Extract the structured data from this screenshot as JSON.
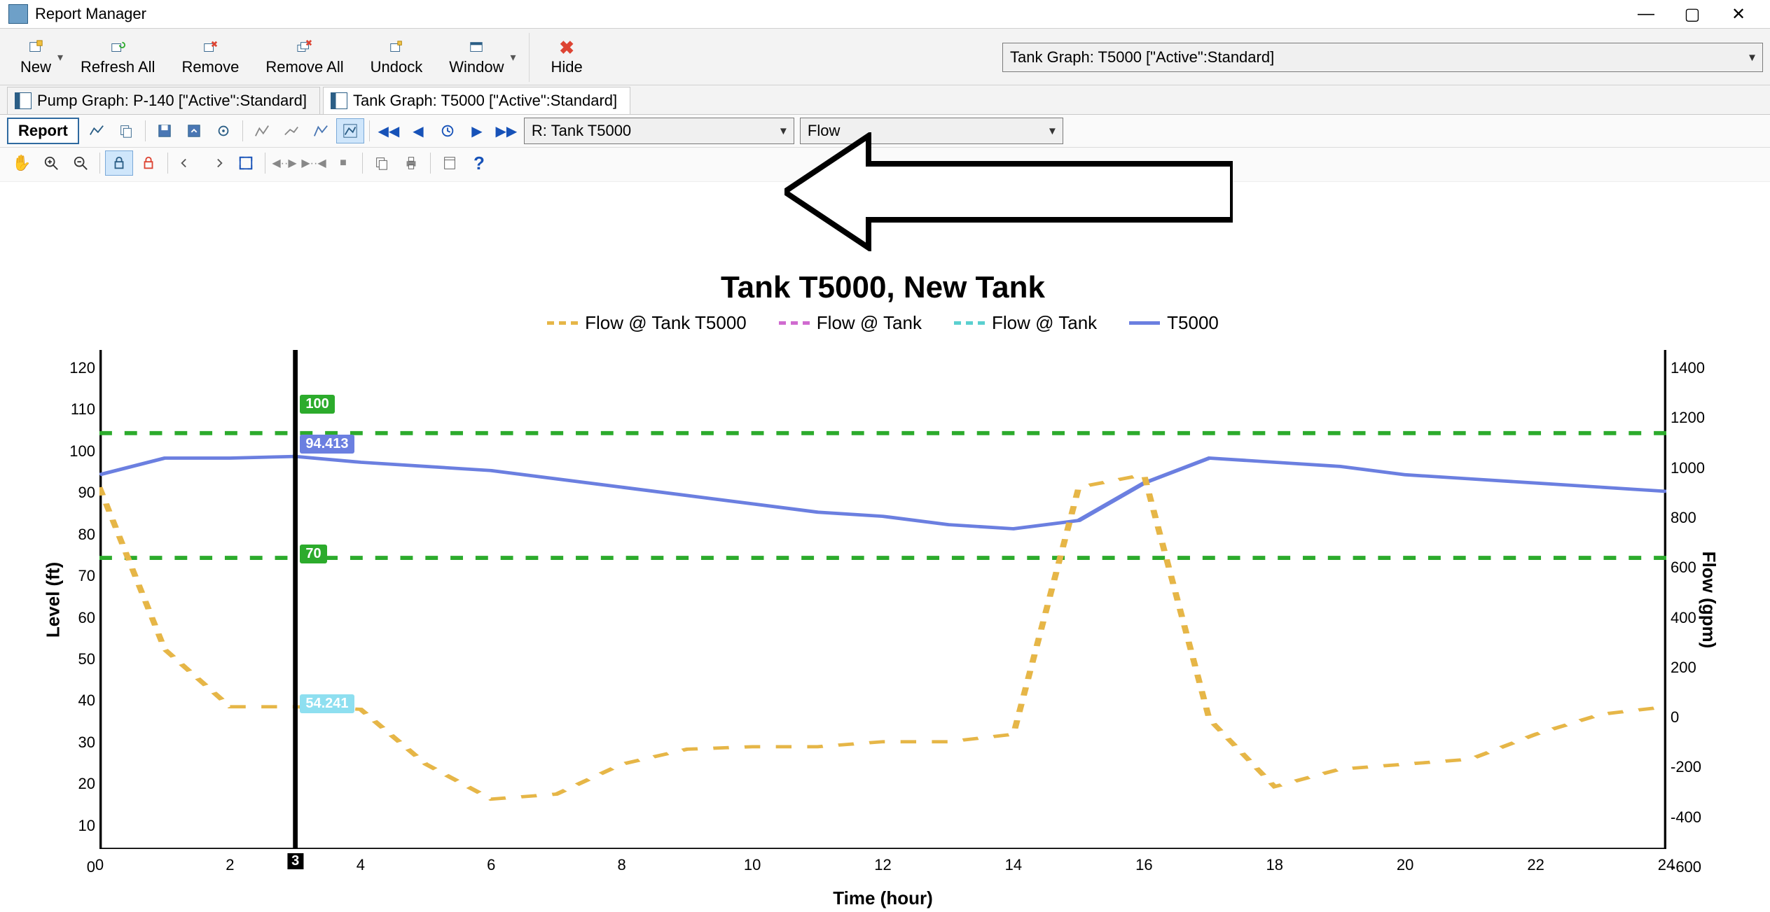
{
  "window": {
    "title": "Report Manager"
  },
  "ribbon": {
    "new": "New",
    "refresh_all": "Refresh All",
    "remove": "Remove",
    "remove_all": "Remove All",
    "undock": "Undock",
    "window": "Window",
    "hide": "Hide",
    "scenario_selected": "Tank Graph: T5000 [\"Active\":Standard]"
  },
  "doc_tabs": {
    "tab1": "Pump Graph: P-140 [\"Active\":Standard]",
    "tab2": "Tank Graph: T5000 [\"Active\":Standard]"
  },
  "chart_toolbar": {
    "report_btn": "Report",
    "element_dd": "R: Tank T5000",
    "property_dd": "Flow"
  },
  "chart_labels": {
    "title": "Tank T5000, New Tank",
    "legend": {
      "s1": "Flow @ Tank T5000",
      "s2": "Flow @ Tank",
      "s3": "Flow @ Tank",
      "s4": "T5000"
    },
    "xaxis": "Time (hour)",
    "yaxis_left": "Level (ft)",
    "yaxis_right": "Flow (gpm)"
  },
  "cursor": {
    "x": "3",
    "top_band": "100",
    "level_val": "94.413",
    "bottom_band": "70",
    "flow_val": "54.241"
  },
  "chart_data": {
    "type": "line",
    "title": "Tank T5000, New Tank",
    "xlabel": "Time (hour)",
    "x": [
      0,
      1,
      2,
      3,
      4,
      5,
      6,
      7,
      8,
      9,
      10,
      11,
      12,
      13,
      14,
      15,
      16,
      17,
      18,
      19,
      20,
      21,
      22,
      23,
      24
    ],
    "x_ticks": [
      0,
      2,
      4,
      6,
      8,
      10,
      12,
      14,
      16,
      18,
      20,
      22,
      24
    ],
    "y_left": {
      "label": "Level (ft)",
      "range": [
        0,
        120
      ],
      "ticks": [
        0,
        10,
        20,
        30,
        40,
        50,
        60,
        70,
        80,
        90,
        100,
        110,
        120
      ]
    },
    "y_right": {
      "label": "Flow (gpm)",
      "range": [
        -600,
        1400
      ],
      "ticks": [
        -600,
        -400,
        -200,
        0,
        200,
        400,
        600,
        800,
        1000,
        1200,
        1400
      ]
    },
    "reference_lines": [
      {
        "axis": "left",
        "value": 100,
        "color": "#2cab2c",
        "style": "dashed"
      },
      {
        "axis": "left",
        "value": 70,
        "color": "#2cab2c",
        "style": "dashed"
      }
    ],
    "cursor_x": 3,
    "cursor_readouts": [
      {
        "series": "upper-band",
        "value": 100
      },
      {
        "series": "T5000",
        "value": 94.413
      },
      {
        "series": "lower-band",
        "value": 70
      },
      {
        "series": "Flow @ Tank",
        "value": 54.241
      }
    ],
    "series": [
      {
        "name": "T5000",
        "axis": "left",
        "color": "#6b7fe0",
        "style": "solid",
        "values": [
          90,
          94,
          94,
          94.4,
          93,
          92,
          91,
          89,
          87,
          85,
          83,
          81,
          80,
          78,
          77,
          79,
          88,
          94,
          93,
          92,
          90,
          89,
          88,
          87,
          86
        ]
      },
      {
        "name": "Flow @ Tank T5000",
        "axis": "right",
        "color": "#e6b647",
        "style": "dashed",
        "values": [
          850,
          200,
          -30,
          -30,
          -40,
          -260,
          -400,
          -380,
          -260,
          -200,
          -190,
          -190,
          -170,
          -170,
          -140,
          850,
          900,
          -80,
          -350,
          -280,
          -260,
          -240,
          -140,
          -60,
          -30
        ]
      },
      {
        "name": "Flow @ Tank (upper band)",
        "axis": "left",
        "color": "#2cab2c",
        "style": "dashed",
        "values": [
          100,
          100,
          100,
          100,
          100,
          100,
          100,
          100,
          100,
          100,
          100,
          100,
          100,
          100,
          100,
          100,
          100,
          100,
          100,
          100,
          100,
          100,
          100,
          100,
          100
        ]
      },
      {
        "name": "Flow @ Tank (lower band)",
        "axis": "left",
        "color": "#2cab2c",
        "style": "dashed",
        "values": [
          70,
          70,
          70,
          70,
          70,
          70,
          70,
          70,
          70,
          70,
          70,
          70,
          70,
          70,
          70,
          70,
          70,
          70,
          70,
          70,
          70,
          70,
          70,
          70,
          70
        ]
      }
    ]
  }
}
